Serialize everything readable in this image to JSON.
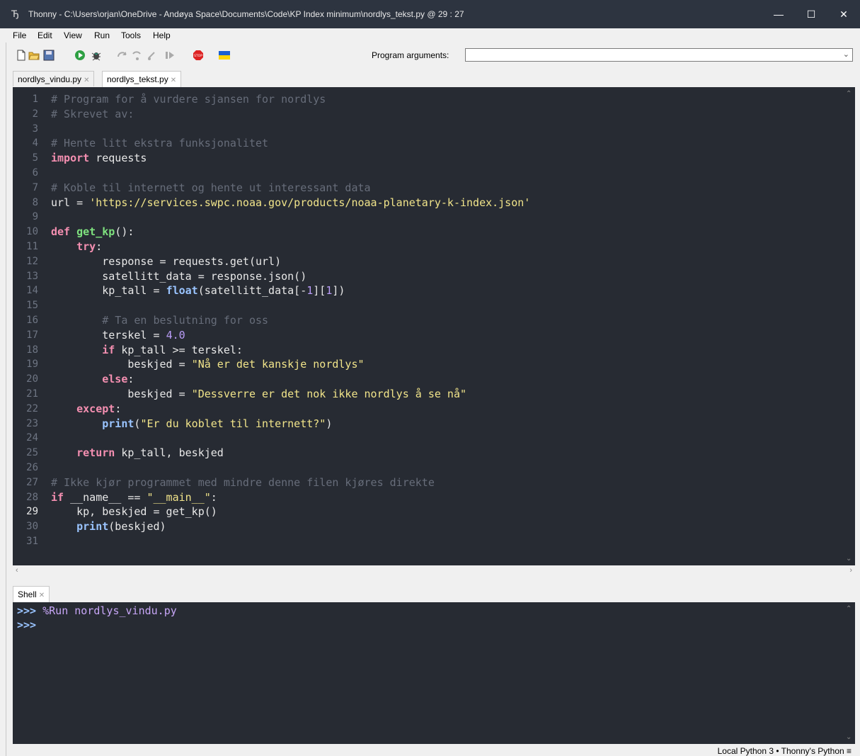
{
  "window": {
    "title": "Thonny  -  C:\\Users\\orjan\\OneDrive - Andøya Space\\Documents\\Code\\KP Index minimum\\nordlys_tekst.py  @  29 : 27",
    "minimize": "—",
    "maximize": "☐",
    "close": "✕"
  },
  "menu": [
    "File",
    "Edit",
    "View",
    "Run",
    "Tools",
    "Help"
  ],
  "toolbar": {
    "program_arguments_label": "Program arguments:",
    "program_arguments_value": ""
  },
  "tabs": [
    {
      "label": "nordlys_vindu.py",
      "active": false
    },
    {
      "label": "nordlys_tekst.py",
      "active": true
    }
  ],
  "editor": {
    "line_numbers": [
      "1",
      "2",
      "3",
      "4",
      "5",
      "6",
      "7",
      "8",
      "9",
      "10",
      "11",
      "12",
      "13",
      "14",
      "15",
      "16",
      "17",
      "18",
      "19",
      "20",
      "21",
      "22",
      "23",
      "24",
      "25",
      "26",
      "27",
      "28",
      "29",
      "30",
      "31"
    ],
    "current_line": 29,
    "lines": [
      "# Program for å vurdere sjansen for nordlys",
      "# Skrevet av:",
      "",
      "# Hente litt ekstra funksjonalitet",
      "import requests",
      "",
      "# Koble til internett og hente ut interessant data",
      "url = 'https://services.swpc.noaa.gov/products/noaa-planetary-k-index.json'",
      "",
      "def get_kp():",
      "    try:",
      "        response = requests.get(url)",
      "        satellitt_data = response.json()",
      "        kp_tall = float(satellitt_data[-1][1])",
      "",
      "        # Ta en beslutning for oss",
      "        terskel = 4.0",
      "        if kp_tall >= terskel:",
      "            beskjed = \"Nå er det kanskje nordlys\"",
      "        else:",
      "            beskjed = \"Dessverre er det nok ikke nordlys å se nå\"",
      "    except:",
      "        print(\"Er du koblet til internett?\")",
      "",
      "    return kp_tall, beskjed",
      "",
      "# Ikke kjør programmet med mindre denne filen kjøres direkte",
      "if __name__ == \"__main__\":",
      "    kp, beskjed = get_kp()",
      "    print(beskjed)",
      ""
    ]
  },
  "shell": {
    "tab_label": "Shell",
    "prompt": ">>>",
    "command": "%Run nordlys_vindu.py"
  },
  "status": {
    "text": "Local Python 3  •  Thonny's Python  ≡"
  },
  "colors": {
    "editor_bg": "#272b33",
    "titlebar_bg": "#2d3440",
    "comment": "#676d7a",
    "string": "#f1e48a",
    "keyword": "#f48fb1"
  }
}
